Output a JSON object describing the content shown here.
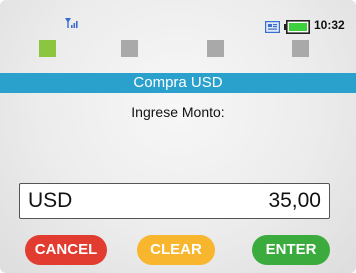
{
  "status": {
    "time": "10:32",
    "signal_icon": "signal-icon",
    "sim_icon": "sim-card-icon",
    "battery_icon": "battery-icon",
    "battery_color": "#3cd13c",
    "indicators": [
      {
        "name": "indicator-1",
        "color": "#8cc63f",
        "active": true
      },
      {
        "name": "indicator-2",
        "color": "#a9a9a9",
        "active": false
      },
      {
        "name": "indicator-3",
        "color": "#a9a9a9",
        "active": false
      },
      {
        "name": "indicator-4",
        "color": "#a9a9a9",
        "active": false
      }
    ]
  },
  "title": "Compra USD",
  "prompt": "Ingrese Monto:",
  "amount": {
    "currency": "USD",
    "value": "35,00"
  },
  "buttons": {
    "cancel": "CANCEL",
    "clear": "CLEAR",
    "enter": "ENTER"
  },
  "colors": {
    "title_bar": "#2aa0cc",
    "cancel": "#e23b2f",
    "clear": "#f8b62e",
    "enter": "#3cab3e"
  }
}
